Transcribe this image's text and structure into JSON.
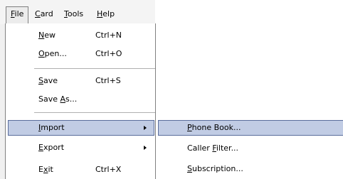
{
  "menubar": {
    "items": [
      {
        "pre": "",
        "key": "F",
        "post": "ile"
      },
      {
        "pre": "",
        "key": "C",
        "post": "ard"
      },
      {
        "pre": "",
        "key": "T",
        "post": "ools"
      },
      {
        "pre": "",
        "key": "H",
        "post": "elp"
      }
    ]
  },
  "file_menu": {
    "items": [
      {
        "pre": "",
        "key": "N",
        "post": "ew",
        "shortcut": "Ctrl+N"
      },
      {
        "pre": "",
        "key": "O",
        "post": "pen...",
        "shortcut": "Ctrl+O"
      },
      {
        "pre": "",
        "key": "S",
        "post": "ave",
        "shortcut": "Ctrl+S"
      },
      {
        "pre": "Save ",
        "key": "A",
        "post": "s..."
      },
      {
        "pre": "",
        "key": "I",
        "post": "mport"
      },
      {
        "pre": "",
        "key": "E",
        "post": "xport"
      },
      {
        "pre": "E",
        "key": "x",
        "post": "it",
        "shortcut": "Ctrl+X"
      }
    ]
  },
  "import_submenu": {
    "items": [
      {
        "pre": "",
        "key": "P",
        "post": "hone Book..."
      },
      {
        "pre": "Caller ",
        "key": "F",
        "post": "ilter..."
      },
      {
        "pre": "",
        "key": "S",
        "post": "ubscription..."
      }
    ]
  }
}
